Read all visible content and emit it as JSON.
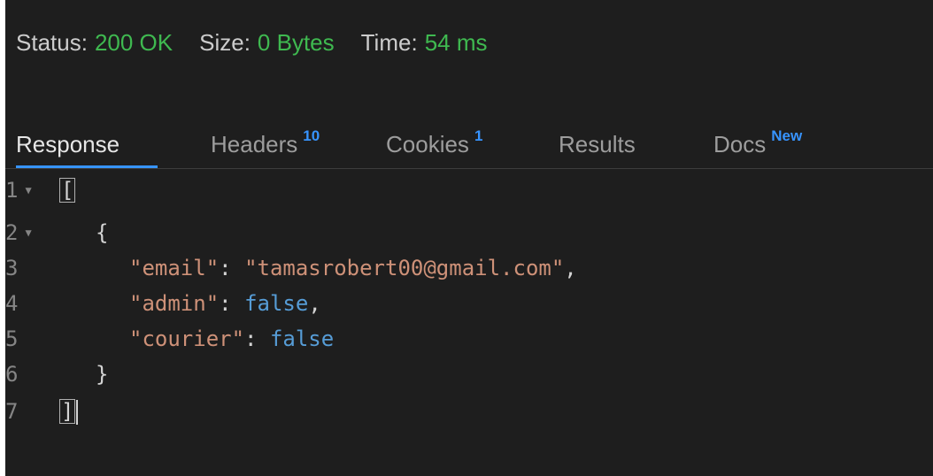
{
  "status": {
    "status_label": "Status:",
    "status_value": "200 OK",
    "size_label": "Size:",
    "size_value": "0 Bytes",
    "time_label": "Time:",
    "time_value": "54 ms"
  },
  "tabs": [
    {
      "label": "Response",
      "badge": "",
      "active": true
    },
    {
      "label": "Headers",
      "badge": "10",
      "active": false
    },
    {
      "label": "Cookies",
      "badge": "1",
      "active": false
    },
    {
      "label": "Results",
      "badge": "",
      "active": false
    },
    {
      "label": "Docs",
      "badge": "New",
      "active": false
    }
  ],
  "editor": {
    "line_numbers": [
      "1",
      "2",
      "3",
      "4",
      "5",
      "6",
      "7"
    ],
    "open_bracket": "[",
    "open_brace": "{",
    "email_key": "\"email\"",
    "email_value": "\"tamasrobert00@gmail.com\"",
    "admin_key": "\"admin\"",
    "admin_value": "false",
    "courier_key": "\"courier\"",
    "courier_value": "false",
    "close_brace": "}",
    "close_bracket": "]",
    "colon": ": ",
    "comma": ","
  },
  "colors": {
    "background": "#1e1e1e",
    "status_value": "#3fb950",
    "accent": "#3794ff",
    "json_string": "#ce9178",
    "json_boolean": "#569cd6"
  },
  "icons": {
    "fold_arrow": "chevron-down-icon"
  }
}
